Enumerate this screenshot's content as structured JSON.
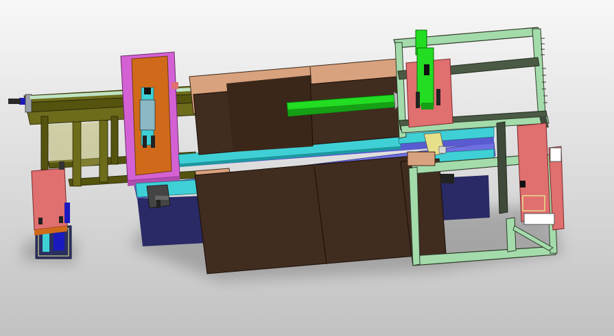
{
  "scene": {
    "kind": "cad-assembly-render",
    "view": "isometric",
    "text_labels": []
  },
  "colors": {
    "background_light": "#f7f7f7",
    "background_dark": "#c2c2c2",
    "table_top": "#d9a27e",
    "table_body": "#412c20",
    "conveyor_rail": "#3fd0d6",
    "conveyor_base": "#6e6fe0",
    "base_shadow": "#2a2a66",
    "frame_olive": "#6d6c1b",
    "frame_mint": "#a4dbab",
    "frame_dark": "#3f4a3a",
    "plate_magenta": "#d461d4",
    "plate_orange": "#d06a1a",
    "plate_salmon": "#e06f6f",
    "pusher_green": "#22dd22",
    "actuator_blue": "#1a1abf",
    "bracket_yellow": "#e6e08a",
    "gray_steel": "#8a8a8a"
  }
}
